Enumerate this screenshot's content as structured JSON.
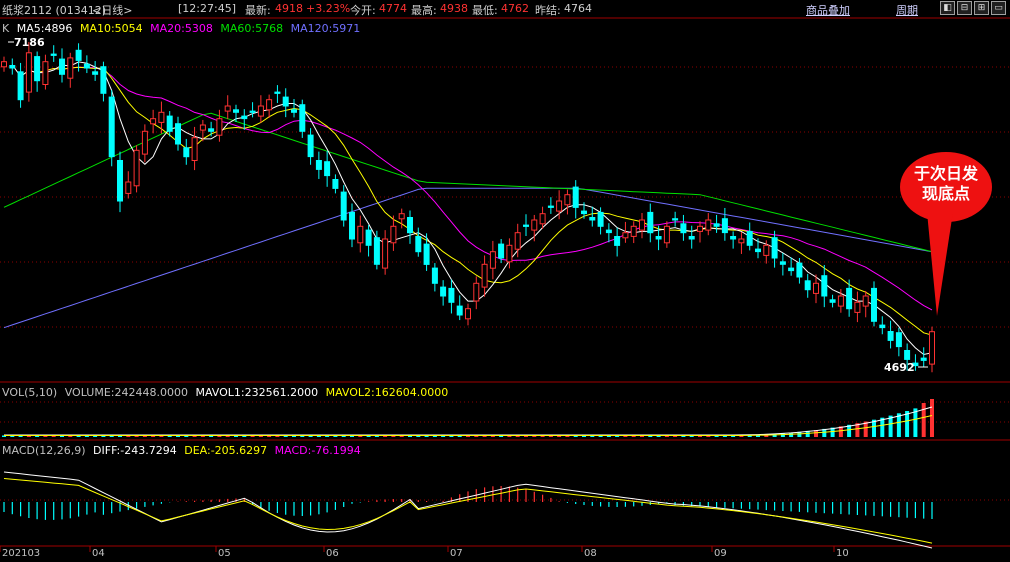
{
  "header": {
    "symbol": "纸浆2112 (013412)",
    "period": "<日线>",
    "time": "[12:27:45]",
    "latest_label": "最新:",
    "latest_value": "4918",
    "change": "+3.23%",
    "open_label": "今开:",
    "open_value": "4774",
    "high_label": "最高:",
    "high_value": "4938",
    "low_label": "最低:",
    "low_value": "4762",
    "prev_close_label": "昨结:",
    "prev_close_value": "4764",
    "overlay_link": "商品叠加",
    "period_link": "周期",
    "window_buttons": [
      "◧",
      "⊟",
      "⊞",
      "▭"
    ]
  },
  "ma_legend": {
    "k": "K",
    "ma5": "MA5:4896",
    "ma10": "MA10:5054",
    "ma20": "MA20:5308",
    "ma60": "MA60:5768",
    "ma120": "MA120:5971"
  },
  "annotations": {
    "high_mark": "7186",
    "low_mark": "4692",
    "bubble_line1": "于次日发",
    "bubble_line2": "现底点"
  },
  "volume_legend": {
    "name": "VOL(5,10)",
    "volume": "VOLUME:242448.0000",
    "mavol1": "MAVOL1:232561.2000",
    "mavol2": "MAVOL2:162604.0000"
  },
  "macd_legend": {
    "name": "MACD(12,26,9)",
    "diff": "DIFF:-243.7294",
    "dea": "DEA:-205.6297",
    "macd": "MACD:-76.1994"
  },
  "x_axis": [
    "202103",
    "04",
    "05",
    "06",
    "07",
    "08",
    "09",
    "10"
  ],
  "colors": {
    "up": "#ff3232",
    "down": "#00ffff",
    "ma5": "#ffffff",
    "ma10": "#ffff00",
    "ma20": "#ff00ff",
    "ma60": "#00e000",
    "ma120": "#7070ff",
    "grid": "#8b0000",
    "bubble": "#ee1111"
  },
  "chart_data": {
    "type": "candlestick",
    "close": [
      7050,
      7000,
      6750,
      7120,
      6900,
      7050,
      7100,
      6950,
      7080,
      7060,
      7000,
      6950,
      6800,
      6300,
      5950,
      6100,
      6350,
      6500,
      6600,
      6650,
      6500,
      6400,
      6300,
      6450,
      6550,
      6500,
      6600,
      6700,
      6650,
      6600,
      6650,
      6700,
      6750,
      6800,
      6700,
      6650,
      6500,
      6300,
      6200,
      6150,
      6050,
      5800,
      5650,
      5750,
      5600,
      5450,
      5650,
      5750,
      5850,
      5700,
      5550,
      5450,
      5300,
      5200,
      5150,
      5050,
      5100,
      5300,
      5450,
      5550,
      5500,
      5600,
      5700,
      5750,
      5800,
      5850,
      5900,
      5950,
      6000,
      5900,
      5850,
      5800,
      5750,
      5700,
      5600,
      5700,
      5750,
      5800,
      5700,
      5650,
      5750,
      5800,
      5700,
      5650,
      5750,
      5800,
      5750,
      5700,
      5650,
      5650,
      5600,
      5550,
      5600,
      5500,
      5450,
      5400,
      5350,
      5250,
      5300,
      5200,
      5150,
      5200,
      5100,
      5150,
      5200,
      5000,
      4950,
      4850,
      4800,
      4700,
      4650,
      4692,
      4918
    ],
    "volume_relative_max": 242448,
    "macd_hist_shape": [
      "negative",
      "small",
      "positive",
      "positive",
      "negative",
      "negative"
    ],
    "high": 7186,
    "low": 4692,
    "last": 4918
  }
}
